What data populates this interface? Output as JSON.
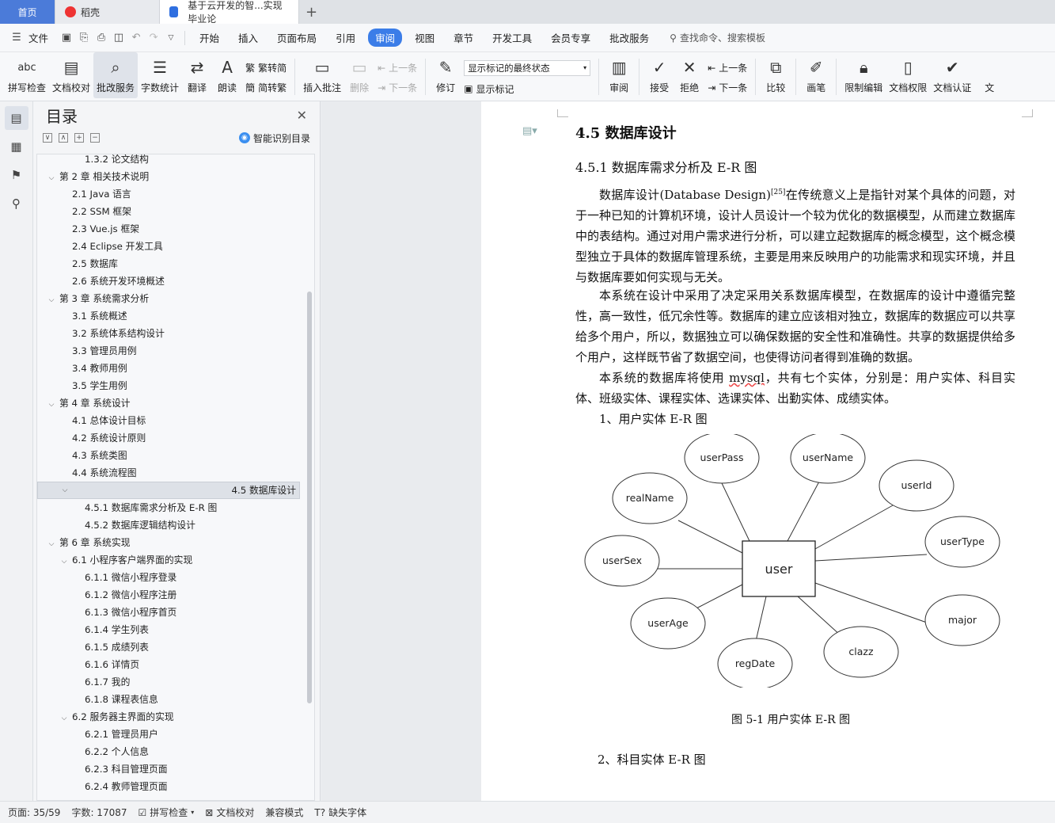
{
  "tabs": {
    "home": "首页",
    "daoke": "稻壳",
    "doc": "基于云开发的智...实现 毕业论"
  },
  "menu": {
    "file": "文件",
    "items": [
      "开始",
      "插入",
      "页面布局",
      "引用",
      "审阅",
      "视图",
      "章节",
      "开发工具",
      "会员专享",
      "批改服务"
    ],
    "active_index": 4,
    "search": "查找命令、搜索模板"
  },
  "ribbon": {
    "spell": "拼写检查",
    "spell_glyph": "abc",
    "proof": "文档校对",
    "correct": "批改服务",
    "count": "字数统计",
    "translate": "翻译",
    "read": "朗读",
    "trad": "繁转简",
    "simp": "简转繁",
    "insert_comment": "插入批注",
    "delete": "删除",
    "prev_c": "上一条",
    "next_c": "下一条",
    "revise": "修订",
    "markup_select": "显示标记的最终状态",
    "show_markup": "显示标记",
    "review": "审阅",
    "accept": "接受",
    "reject": "拒绝",
    "prev": "上一条",
    "next": "下一条",
    "compare": "比较",
    "pen": "画笔",
    "restrict": "限制编辑",
    "rights": "文档权限",
    "certify": "文档认证",
    "more": "文"
  },
  "toc": {
    "title": "目录",
    "smart": "智能识别目录",
    "items": [
      {
        "text": "1.3.2 论文结构",
        "level": 2,
        "chev": ""
      },
      {
        "text": "第 2 章  相关技术说明",
        "level": 0,
        "chev": "v"
      },
      {
        "text": "2.1 Java 语言",
        "level": 1,
        "chev": ""
      },
      {
        "text": "2.2 SSM 框架",
        "level": 1,
        "chev": ""
      },
      {
        "text": "2.3 Vue.js 框架",
        "level": 1,
        "chev": ""
      },
      {
        "text": "2.4 Eclipse 开发工具",
        "level": 1,
        "chev": ""
      },
      {
        "text": "2.5  数据库",
        "level": 1,
        "chev": ""
      },
      {
        "text": "2.6 系统开发环境概述",
        "level": 1,
        "chev": ""
      },
      {
        "text": "第 3 章  系统需求分析",
        "level": 0,
        "chev": "v"
      },
      {
        "text": "3.1 系统概述",
        "level": 1,
        "chev": ""
      },
      {
        "text": "3.2 系统体系结构设计",
        "level": 1,
        "chev": ""
      },
      {
        "text": "3.3 管理员用例",
        "level": 1,
        "chev": ""
      },
      {
        "text": "3.4 教师用例",
        "level": 1,
        "chev": ""
      },
      {
        "text": "3.5 学生用例",
        "level": 1,
        "chev": ""
      },
      {
        "text": "第 4 章  系统设计",
        "level": 0,
        "chev": "v"
      },
      {
        "text": "4.1 总体设计目标",
        "level": 1,
        "chev": ""
      },
      {
        "text": "4.2 系统设计原则",
        "level": 1,
        "chev": ""
      },
      {
        "text": "4.3 系统类图",
        "level": 1,
        "chev": ""
      },
      {
        "text": "4.4 系统流程图",
        "level": 1,
        "chev": ""
      },
      {
        "text": "4.5 数据库设计",
        "level": 1,
        "chev": "v",
        "selected": true
      },
      {
        "text": "4.5.1 数据库需求分析及 E-R 图",
        "level": 2,
        "chev": ""
      },
      {
        "text": "4.5.2  数据库逻辑结构设计",
        "level": 2,
        "chev": ""
      },
      {
        "text": "第 6 章  系统实现",
        "level": 0,
        "chev": "v"
      },
      {
        "text": "6.1  小程序客户端界面的实现",
        "level": 1,
        "chev": "v"
      },
      {
        "text": "6.1.1  微信小程序登录",
        "level": 2,
        "chev": ""
      },
      {
        "text": "6.1.2 微信小程序注册",
        "level": 2,
        "chev": ""
      },
      {
        "text": "6.1.3 微信小程序首页",
        "level": 2,
        "chev": ""
      },
      {
        "text": "6.1.4 学生列表",
        "level": 2,
        "chev": ""
      },
      {
        "text": "6.1.5 成绩列表",
        "level": 2,
        "chev": ""
      },
      {
        "text": "6.1.6 详情页",
        "level": 2,
        "chev": ""
      },
      {
        "text": "6.1.7 我的",
        "level": 2,
        "chev": ""
      },
      {
        "text": "6.1.8 课程表信息",
        "level": 2,
        "chev": ""
      },
      {
        "text": "6.2  服务器主界面的实现",
        "level": 1,
        "chev": "v"
      },
      {
        "text": "6.2.1 管理员用户",
        "level": 2,
        "chev": ""
      },
      {
        "text": "6.2.2 个人信息",
        "level": 2,
        "chev": ""
      },
      {
        "text": "6.2.3 科目管理页面",
        "level": 2,
        "chev": ""
      },
      {
        "text": "6.2.4 教师管理页面",
        "level": 2,
        "chev": ""
      }
    ]
  },
  "doc": {
    "h2": "4.5 数据库设计",
    "h3": "4.5.1 数据库需求分析及 E-R 图",
    "p1_a": "数据库设计(Database Design)",
    "p1_sup": "[25]",
    "p1_b": "在传统意义上是指针对某个具体的问题，对于一种已知的计算机环境，设计人员设计一个较为优化的数据模型，从而建立数据库中的表结构。通过对用户需求进行分析，可以建立起数据库的概念模型，这个概念模型独立于具体的数据库管理系统，主要是用来反映用户的功能需求和现实环境，并且与数据库要如何实现与无关。",
    "p2": "本系统在设计中采用了决定采用关系数据库模型，在数据库的设计中遵循完整性，高一致性，低冗余性等。数据库的建立应该相对独立，数据库的数据应可以共享给多个用户，所以，数据独立可以确保数据的安全性和准确性。共享的数据提供给多个用户，这样既节省了数据空间，也使得访问者得到准确的数据。",
    "p3_a": "本系统的数据库将使用 ",
    "p3_ul": "mysql",
    "p3_b": "，共有七个实体，分别是：用户实体、科目实体、班级实体、课程实体、选课实体、出勤实体、成绩实体。",
    "p4": "1、用户实体 E-R 图",
    "er_center": "user",
    "er_attrs": [
      "userPass",
      "userName",
      "userId",
      "realName",
      "userType",
      "userSex",
      "major",
      "userAge",
      "clazz",
      "regDate"
    ],
    "caption": "图 5-1   用户实体 E-R 图",
    "sub2": "2、科目实体 E-R 图"
  },
  "status": {
    "page": "页面: 35/59",
    "words": "字数: 17087",
    "spell": "拼写检查",
    "proof": "文档校对",
    "compat": "兼容模式",
    "font": "缺失字体"
  }
}
